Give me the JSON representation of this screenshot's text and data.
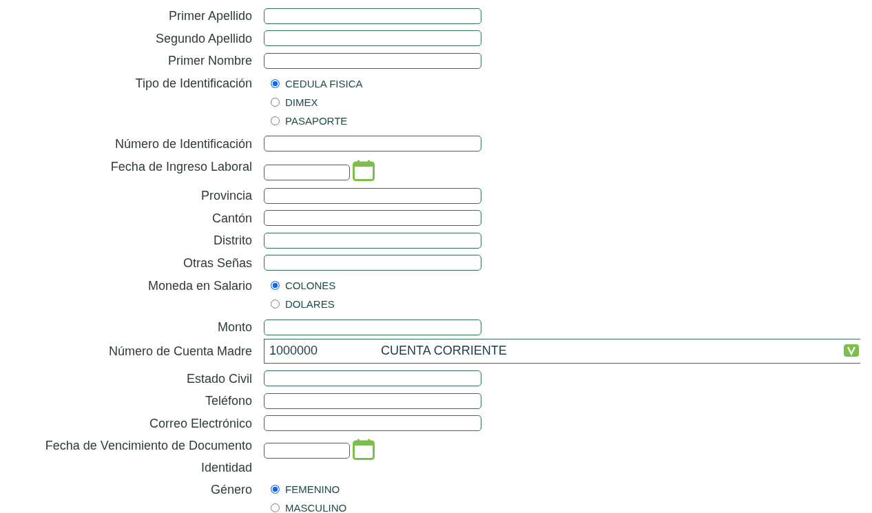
{
  "form": {
    "rows": [
      {
        "kind": "text",
        "label": "Primer Apellido"
      },
      {
        "kind": "text",
        "label": "Segundo Apellido"
      },
      {
        "kind": "text",
        "label": "Primer Nombre"
      },
      {
        "kind": "radio",
        "label": "Tipo de Identificación",
        "options": [
          {
            "label": "CEDULA FISICA",
            "selected": true
          },
          {
            "label": "DIMEX",
            "selected": false
          },
          {
            "label": "PASAPORTE",
            "selected": false
          }
        ]
      },
      {
        "kind": "text",
        "label": "Número de Identificación"
      },
      {
        "kind": "date",
        "label": "Fecha de Ingreso Laboral"
      },
      {
        "kind": "text",
        "label": "Provincia"
      },
      {
        "kind": "text",
        "label": "Cantón"
      },
      {
        "kind": "text",
        "label": "Distrito"
      },
      {
        "kind": "text",
        "label": "Otras Señas"
      },
      {
        "kind": "radio",
        "label": "Moneda en Salario",
        "options": [
          {
            "label": "COLONES",
            "selected": true
          },
          {
            "label": "DOLARES",
            "selected": false
          }
        ]
      },
      {
        "kind": "text",
        "label": "Monto"
      },
      {
        "kind": "select",
        "label": "Número de Cuenta Madre",
        "account_number": "1000000",
        "account_type": "CUENTA CORRIENTE"
      },
      {
        "kind": "text",
        "label": "Estado Civil"
      },
      {
        "kind": "text",
        "label": "Teléfono"
      },
      {
        "kind": "text",
        "label": "Correo Electrónico"
      },
      {
        "kind": "date",
        "label": "Fecha de Vencimiento de Documento Identidad"
      },
      {
        "kind": "radio",
        "label": "Género",
        "options": [
          {
            "label": "FEMENINO",
            "selected": true
          },
          {
            "label": "MASCULINO",
            "selected": false
          }
        ]
      }
    ]
  }
}
